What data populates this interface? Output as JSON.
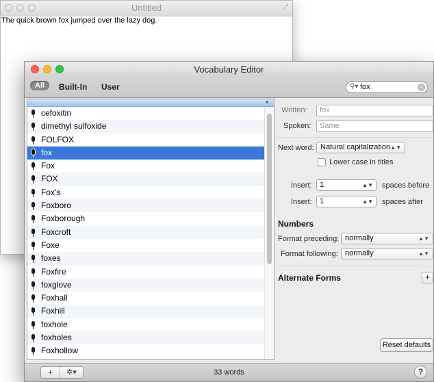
{
  "background_window": {
    "title": "Untitled",
    "document_text": "The quick brown fox jumped over the lazy dog."
  },
  "vocab_window": {
    "title": "Vocabulary Editor",
    "scopes": [
      "All",
      "Built-In",
      "User"
    ],
    "search": {
      "value": "fox",
      "icon": "magnifier-icon"
    },
    "words": [
      "cefoxitin",
      "dimethyl sulfoxide",
      "FOLFOX",
      "fox",
      "Fox",
      "FOX",
      "Fox's",
      "Foxboro",
      "Foxborough",
      "Foxcroft",
      "Foxe",
      "foxes",
      "Foxfire",
      "foxglove",
      "Foxhall",
      "Foxhill",
      "foxhole",
      "foxholes",
      "Foxhollow"
    ],
    "selected_word": "fox",
    "details": {
      "written_label": "Written:",
      "written_placeholder": "fox",
      "spoken_label": "Spoken:",
      "spoken_placeholder": "Same",
      "next_word_label": "Next word:",
      "next_word_value": "Natural capitalization",
      "lowercase_titles_label": "Lower case in titles",
      "insert_label": "Insert:",
      "insert_before_value": "1",
      "spaces_before_label": "spaces before",
      "insert_after_value": "1",
      "spaces_after_label": "spaces after",
      "numbers_heading": "Numbers",
      "format_preceding_label": "Format preceding:",
      "format_preceding_value": "normally",
      "format_following_label": "Format following:",
      "format_following_value": "normally",
      "alternate_forms_heading": "Alternate Forms",
      "reset_label": "Reset defaults"
    },
    "footer": {
      "word_count": "33 words",
      "help_label": "?"
    }
  },
  "colors": {
    "selection": "#3879d9",
    "close": "#fc5f57",
    "minimize": "#fdbc2e",
    "zoom": "#33c748"
  }
}
